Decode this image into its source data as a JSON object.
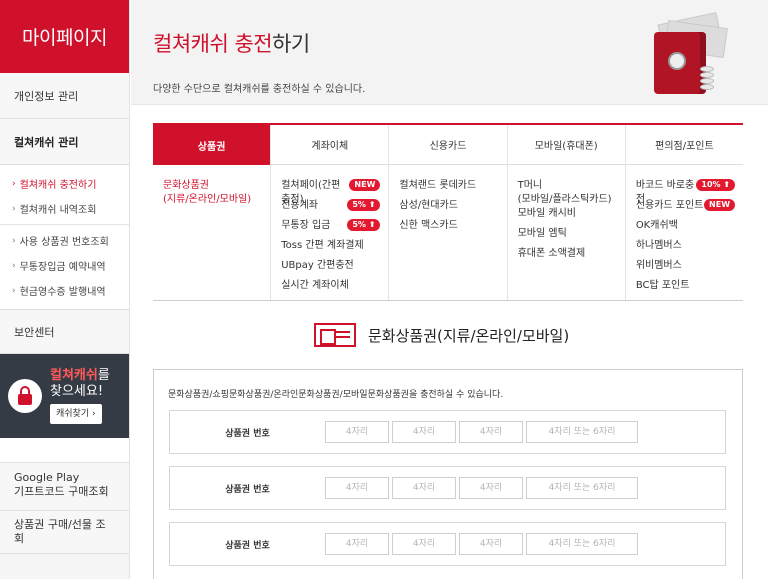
{
  "sidebar": {
    "title": "마이페이지",
    "personal": "개인정보 관리",
    "culture_cash": "컬쳐캐쉬 관리",
    "sub_items": [
      {
        "label": "컬쳐캐쉬 충전하기"
      },
      {
        "label": "컬쳐캐쉬 내역조회"
      },
      {
        "label": "사용 상품권 번호조회"
      },
      {
        "label": "무통장입금 예약내역"
      },
      {
        "label": "현금영수증 발행내역"
      }
    ],
    "security": "보안센터",
    "banner": {
      "line1_hl": "컬쳐캐쉬",
      "line1_rest": "를",
      "line2": "찾으세요!",
      "button": "캐쉬찾기 ›"
    },
    "google_play": {
      "line1": "Google Play",
      "line2": "기프트코드 구매조회"
    },
    "voucher_lookup": "상품권 구매/선물 조회"
  },
  "header": {
    "title_red": "컬쳐캐쉬 충전",
    "title_rest": "하기",
    "desc": "다양한 수단으로 컬쳐캐쉬를 충전하실 수 있습니다."
  },
  "tabs": [
    {
      "label": "상품권",
      "items": [
        {
          "text": "문화상품권\n(지류/온라인/모바일)",
          "badge": ""
        }
      ]
    },
    {
      "label": "계좌이체",
      "items": [
        {
          "text": "컬쳐페이(간편충전)",
          "badge": "NEW"
        },
        {
          "text": "전용계좌",
          "badge": "5% ⬆"
        },
        {
          "text": "무통장 입금",
          "badge": "5% ⬆"
        },
        {
          "text": "Toss 간편 계좌결제",
          "badge": ""
        },
        {
          "text": "UBpay 간편충전",
          "badge": ""
        },
        {
          "text": "실시간 계좌이체",
          "badge": ""
        }
      ]
    },
    {
      "label": "신용카드",
      "items": [
        {
          "text": "컬쳐랜드 롯데카드",
          "badge": ""
        },
        {
          "text": "삼성/현대카드",
          "badge": ""
        },
        {
          "text": "신한 맥스카드",
          "badge": ""
        }
      ]
    },
    {
      "label": "모바일(휴대폰)",
      "items": [
        {
          "text": "T머니\n(모바일/플라스틱카드)",
          "badge": ""
        },
        {
          "text": "모바일 캐시비",
          "badge": ""
        },
        {
          "text": "모바일 엠틱",
          "badge": ""
        },
        {
          "text": "휴대폰 소액결제",
          "badge": ""
        }
      ]
    },
    {
      "label": "편의점/포인트",
      "items": [
        {
          "text": "바코드 바로충전",
          "badge": "10% ⬆"
        },
        {
          "text": "신용카드 포인트",
          "badge": "NEW"
        },
        {
          "text": "OK캐쉬백",
          "badge": ""
        },
        {
          "text": "하나멤버스",
          "badge": ""
        },
        {
          "text": "위비멤버스",
          "badge": ""
        },
        {
          "text": "BC탑 포인트",
          "badge": ""
        }
      ]
    }
  ],
  "section": {
    "title": "문화상품권(지류/온라인/모바일)",
    "desc": "문화상품권/쇼핑문화상품권/온라인문화상품권/모바일문화상품권을 충전하실 수 있습니다."
  },
  "form": {
    "rows": [
      {
        "label": "상품권 번호"
      },
      {
        "label": "상품권 번호"
      },
      {
        "label": "상품권 번호"
      }
    ],
    "ph4": "4자리",
    "ph6": "4자리 또는 6자리"
  },
  "colors": {
    "brand_red": "#d0112b",
    "dark_banner": "#353b45"
  }
}
